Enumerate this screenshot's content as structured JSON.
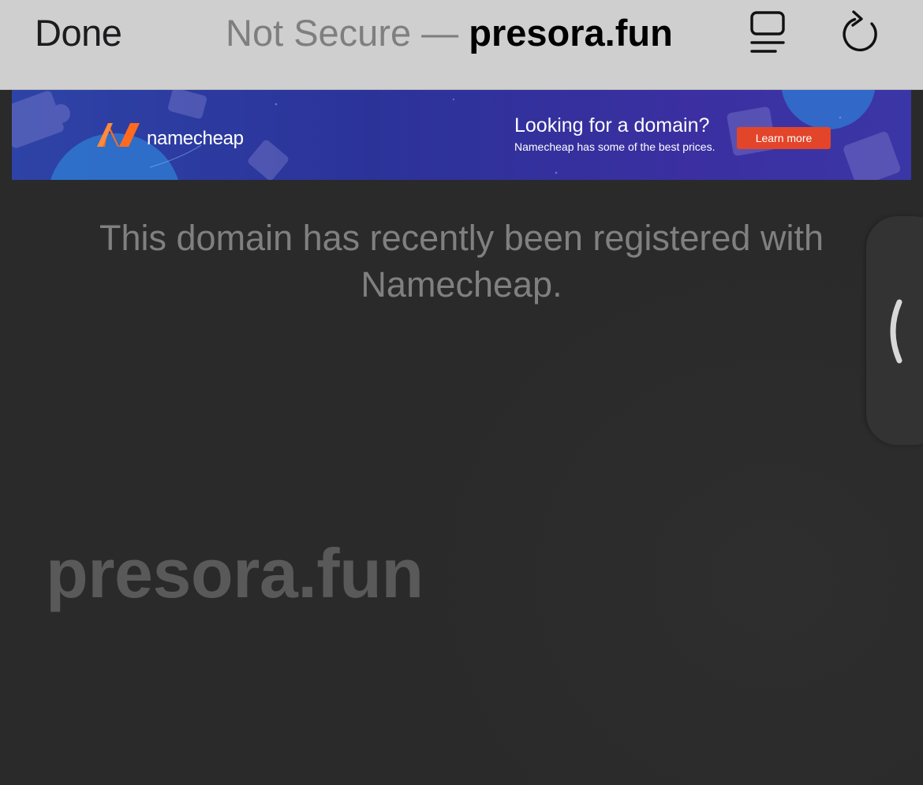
{
  "toolbar": {
    "done_label": "Done",
    "security_label": "Not Secure",
    "separator": " — ",
    "domain": "presora.fun",
    "reader_icon": "reader-mode-icon",
    "reload_icon": "reload-icon"
  },
  "ad": {
    "brand": "namecheap",
    "headline": "Looking for a domain?",
    "subtext": "Namecheap has some of the best prices.",
    "cta_label": "Learn more",
    "colors": {
      "background": "#2b3399",
      "cta": "#e2452a",
      "logo": "#ff6a1f"
    }
  },
  "main": {
    "message": "This domain has recently been registered with Namecheap.",
    "domain_display": "presora.fun"
  },
  "side_panel": {
    "icon": "chevron-left-icon"
  }
}
